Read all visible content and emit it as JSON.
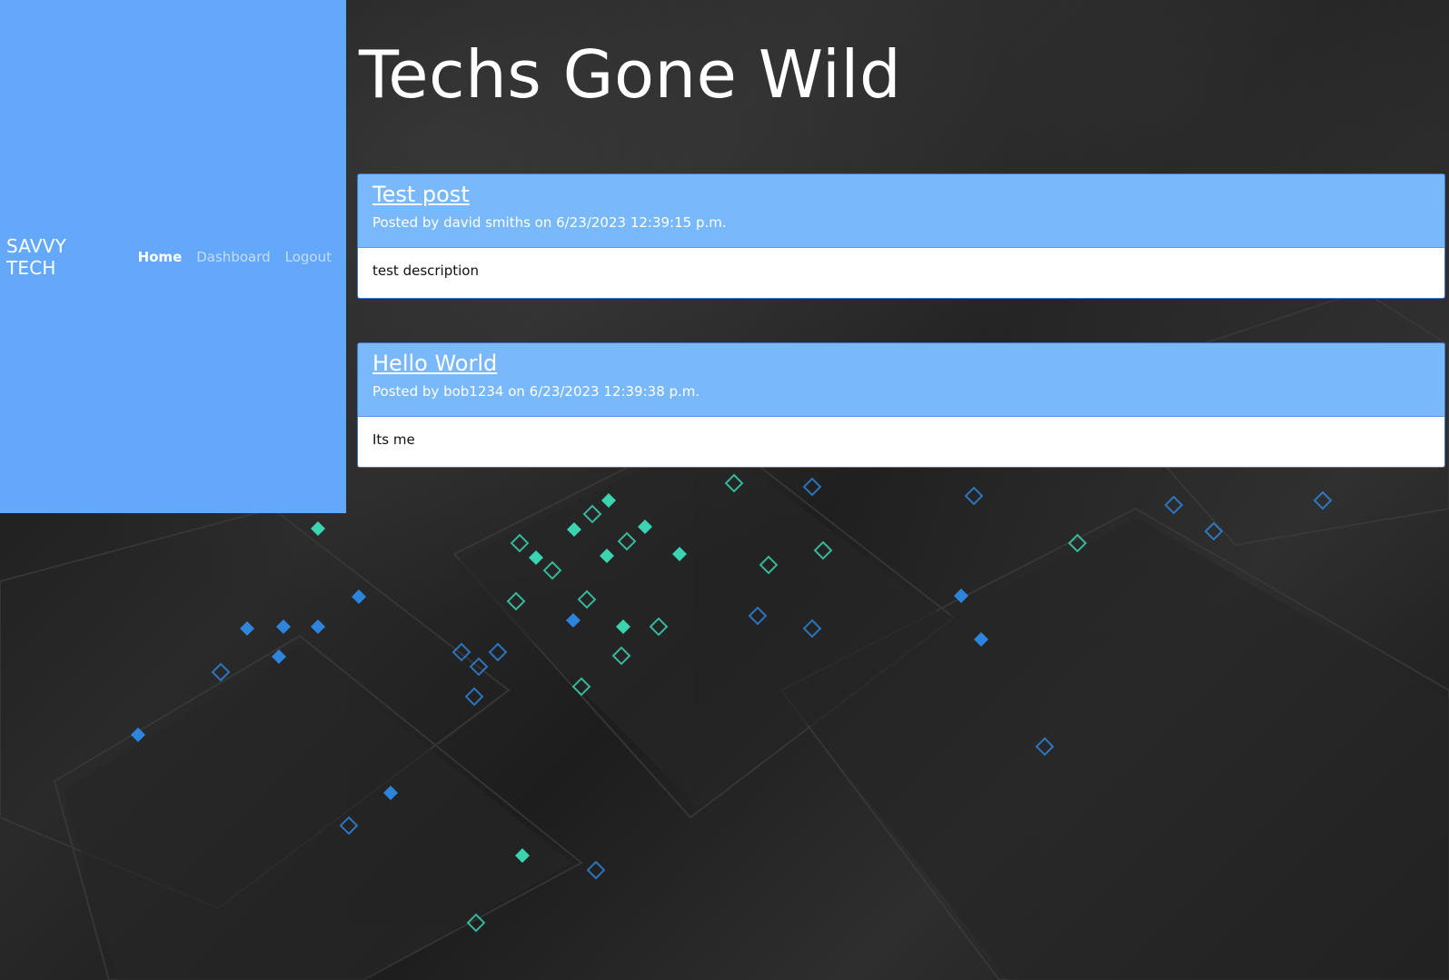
{
  "nav": {
    "brand": "SAVVY TECH",
    "links": [
      {
        "label": "Home",
        "active": true
      },
      {
        "label": "Dashboard",
        "active": false
      },
      {
        "label": "Logout",
        "active": false
      }
    ]
  },
  "page": {
    "title": "Techs Gone Wild"
  },
  "posts": [
    {
      "title": "Test post",
      "meta": "Posted by david smiths on 6/23/2023 12:39:15 p.m.",
      "body": "test description"
    },
    {
      "title": "Hello World",
      "meta": "Posted by bob1234 on 6/23/2023 12:39:38 p.m.",
      "body": "Its me"
    }
  ],
  "colors": {
    "sidebar": "#63a8fa",
    "post_header": "#79b8fb",
    "background": "#1f1f1f",
    "accent_teal": "#3ee8c0",
    "accent_blue": "#2f8ff0"
  }
}
